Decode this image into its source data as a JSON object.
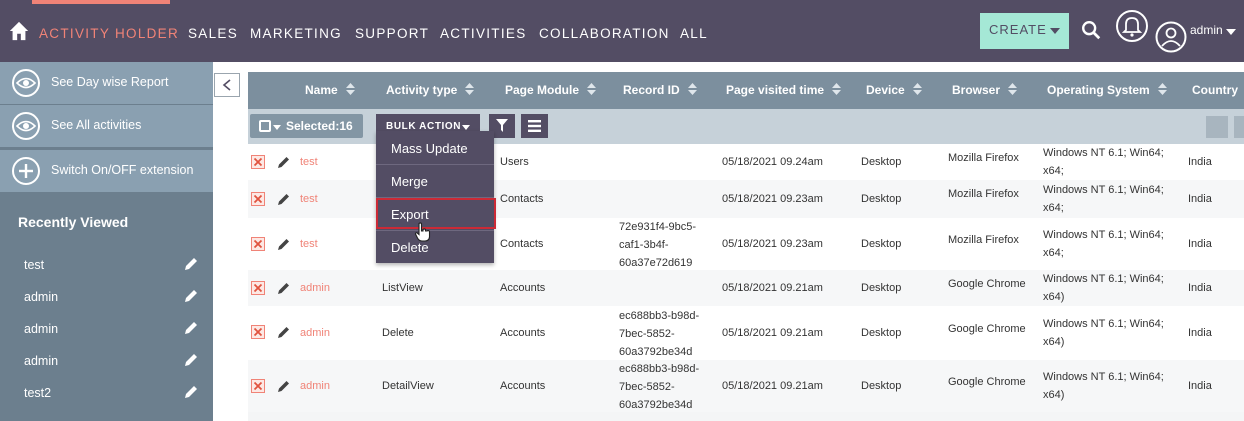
{
  "nav": {
    "brand": "ACTIVITY HOLDER",
    "links": [
      "SALES",
      "MARKETING",
      "SUPPORT",
      "ACTIVITIES",
      "COLLABORATION",
      "ALL"
    ],
    "create_label": "CREATE",
    "user_label": "admin"
  },
  "sidebar": {
    "actions": [
      "See Day wise Report",
      "See All activities",
      "Switch On/OFF extension"
    ],
    "recent_title": "Recently Viewed",
    "recent_items": [
      "test",
      "admin",
      "admin",
      "admin",
      "test2"
    ]
  },
  "table": {
    "columns": [
      "Name",
      "Activity type",
      "Page Module",
      "Record ID",
      "Page visited time",
      "Device",
      "Browser",
      "Operating System",
      "Country"
    ],
    "selected_label": "Selected:16",
    "bulk_action_label": "BULK ACTION",
    "rows": [
      {
        "name": "test",
        "activity": "",
        "module": "Users",
        "record": "",
        "time": "05/18/2021 09.24am",
        "device": "Desktop",
        "browser": "Mozilla Firefox",
        "os": "Windows NT 6.1; Win64; x64;",
        "country": "India"
      },
      {
        "name": "test",
        "activity": "",
        "module": "Contacts",
        "record": "",
        "time": "05/18/2021 09.23am",
        "device": "Desktop",
        "browser": "Mozilla Firefox",
        "os": "Windows NT 6.1; Win64; x64;",
        "country": "India"
      },
      {
        "name": "test",
        "activity": "",
        "module": "Contacts",
        "record": "72e931f4-9bc5-caf1-3b4f-60a37e72d619",
        "time": "05/18/2021 09.23am",
        "device": "Desktop",
        "browser": "Mozilla Firefox",
        "os": "Windows NT 6.1; Win64; x64;",
        "country": "India"
      },
      {
        "name": "admin",
        "activity": "ListView",
        "module": "Accounts",
        "record": "",
        "time": "05/18/2021 09.21am",
        "device": "Desktop",
        "browser": "Google Chrome",
        "os": "Windows NT 6.1; Win64; x64)",
        "country": "India"
      },
      {
        "name": "admin",
        "activity": "Delete",
        "module": "Accounts",
        "record": "ec688bb3-b98d-7bec-5852-60a3792be34d",
        "time": "05/18/2021 09.21am",
        "device": "Desktop",
        "browser": "Google Chrome",
        "os": "Windows NT 6.1; Win64; x64)",
        "country": "India"
      },
      {
        "name": "admin",
        "activity": "DetailView",
        "module": "Accounts",
        "record": "ec688bb3-b98d-7bec-5852-60a3792be34d",
        "time": "05/18/2021 09.21am",
        "device": "Desktop",
        "browser": "Google Chrome",
        "os": "Windows NT 6.1; Win64; x64)",
        "country": "India"
      }
    ]
  },
  "bulk_menu": {
    "items": [
      "Mass Update",
      "Merge",
      "Export",
      "Delete"
    ],
    "highlighted": "Export"
  },
  "colors": {
    "nav_bg": "#534d64",
    "accent": "#f08377",
    "create_bg": "#a5e8d6",
    "sidebar_bg": "#6c7f8e",
    "header_bg": "#7c8f9e",
    "highlight_border": "#cc2a36"
  }
}
